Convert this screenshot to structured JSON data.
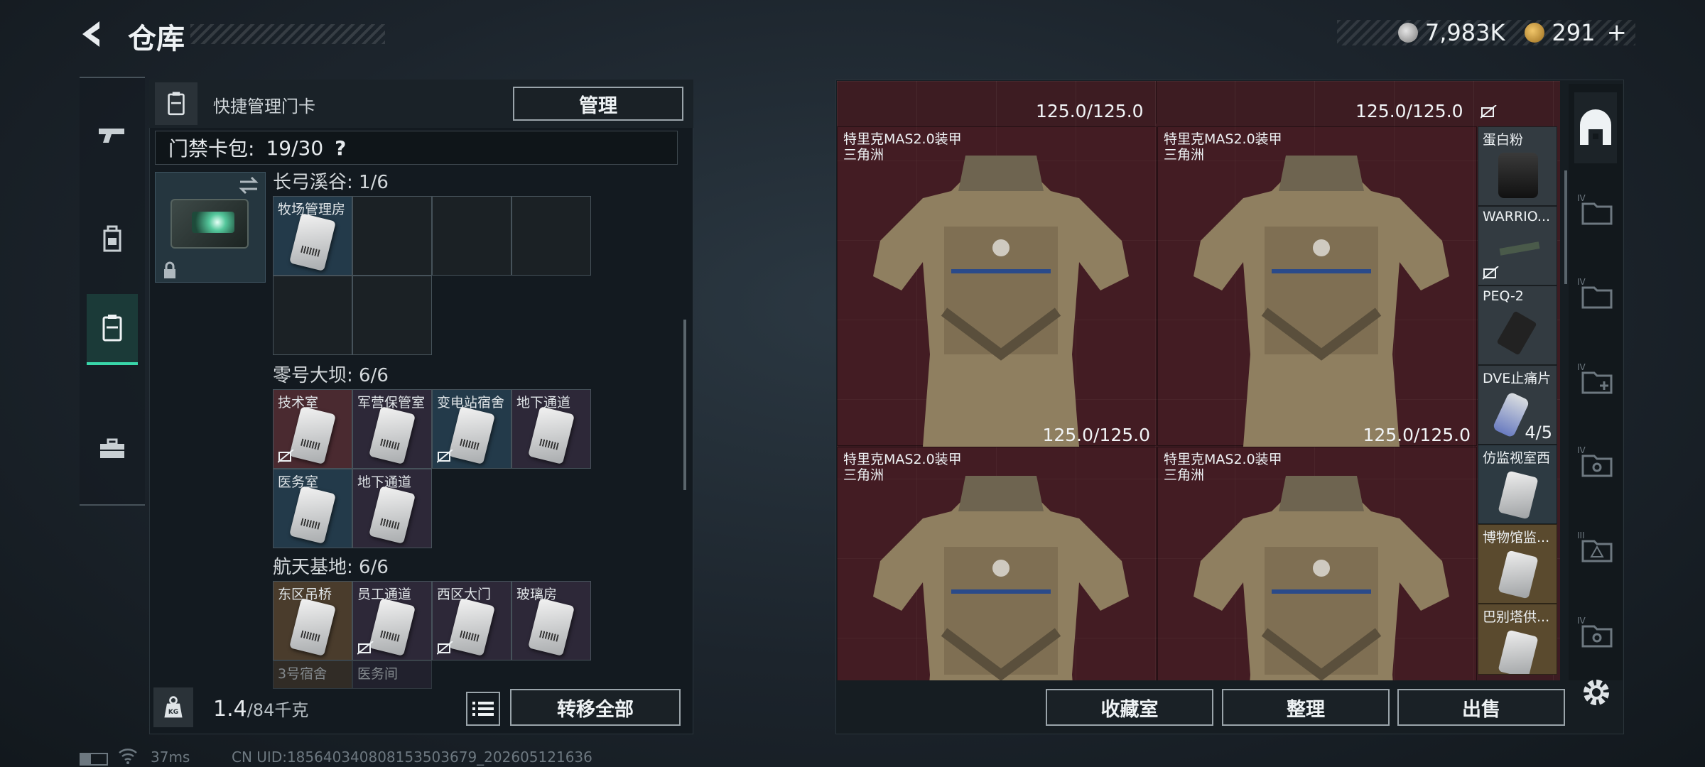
{
  "header": {
    "title": "仓库"
  },
  "currency": {
    "silver": "7,983K",
    "gold": "291",
    "plus": "+"
  },
  "nav": {
    "items": [
      "weapons",
      "equipment",
      "keycards",
      "toolbox"
    ],
    "active": "keycards"
  },
  "left": {
    "quick_title": "快捷管理门卡",
    "manage_label": "管理",
    "capacity_label": "门禁卡包:",
    "capacity_value": "19/30",
    "help_icon": "?",
    "sections": [
      {
        "title": "长弓溪谷: 1/6",
        "cells": [
          {
            "label": "牧场管理房",
            "color": "blue",
            "not_tradeable": false
          },
          {
            "label": "",
            "color": "empty"
          },
          {
            "label": "",
            "color": "empty"
          },
          {
            "label": "",
            "color": "empty"
          },
          {
            "label": "",
            "color": "empty"
          },
          {
            "label": "",
            "color": "empty"
          }
        ]
      },
      {
        "title": "零号大坝: 6/6",
        "cells": [
          {
            "label": "技术室",
            "color": "red",
            "not_tradeable": true
          },
          {
            "label": "军营保管室",
            "color": "purple",
            "not_tradeable": false
          },
          {
            "label": "变电站宿舍",
            "color": "blue",
            "not_tradeable": true
          },
          {
            "label": "地下通道",
            "color": "purple",
            "not_tradeable": false
          },
          {
            "label": "医务室",
            "color": "blue",
            "not_tradeable": false
          },
          {
            "label": "地下通道",
            "color": "purple",
            "not_tradeable": false
          }
        ]
      },
      {
        "title": "航天基地: 6/6",
        "cells": [
          {
            "label": "东区吊桥",
            "color": "gold",
            "not_tradeable": false
          },
          {
            "label": "员工通道",
            "color": "purple",
            "not_tradeable": true
          },
          {
            "label": "西区大门",
            "color": "purple",
            "not_tradeable": true
          },
          {
            "label": "玻璃房",
            "color": "purple",
            "not_tradeable": false
          },
          {
            "label": "3号宿舍",
            "color": "gold",
            "not_tradeable": false
          },
          {
            "label": "医务间",
            "color": "purple",
            "not_tradeable": false
          }
        ]
      }
    ],
    "weight_value": "1.4",
    "weight_max": "/84千克",
    "transfer_label": "转移全部"
  },
  "stash": {
    "top_durability": [
      "125.0/125.0",
      "125.0/125.0"
    ],
    "armors": [
      {
        "name": "特里克MAS2.0装甲",
        "sub": "三角洲",
        "durability": "125.0/125.0"
      },
      {
        "name": "特里克MAS2.0装甲",
        "sub": "三角洲",
        "durability": "125.0/125.0"
      },
      {
        "name": "特里克MAS2.0装甲",
        "sub": "三角洲",
        "durability": ""
      },
      {
        "name": "特里克MAS2.0装甲",
        "sub": "三角洲",
        "durability": ""
      }
    ],
    "side_items": [
      {
        "label": "蛋白粉",
        "count": "",
        "color": "gray"
      },
      {
        "label": "WARRIO...",
        "count": "",
        "color": "gray"
      },
      {
        "label": "PEQ-2",
        "count": "",
        "color": "gray"
      },
      {
        "label": "DVE止痛片",
        "count": "4/5",
        "color": "gray"
      },
      {
        "label": "仿监视室西",
        "count": "",
        "color": "purple"
      },
      {
        "label": "博物馆监...",
        "count": "",
        "color": "gold"
      },
      {
        "label": "巴别塔供...",
        "count": "",
        "color": "gold"
      }
    ],
    "buttons": {
      "collection": "收藏室",
      "organize": "整理",
      "sell": "出售"
    }
  },
  "status": {
    "ping": "37ms",
    "uid": "CN UID:18564034080815350367​9_202605121636"
  }
}
